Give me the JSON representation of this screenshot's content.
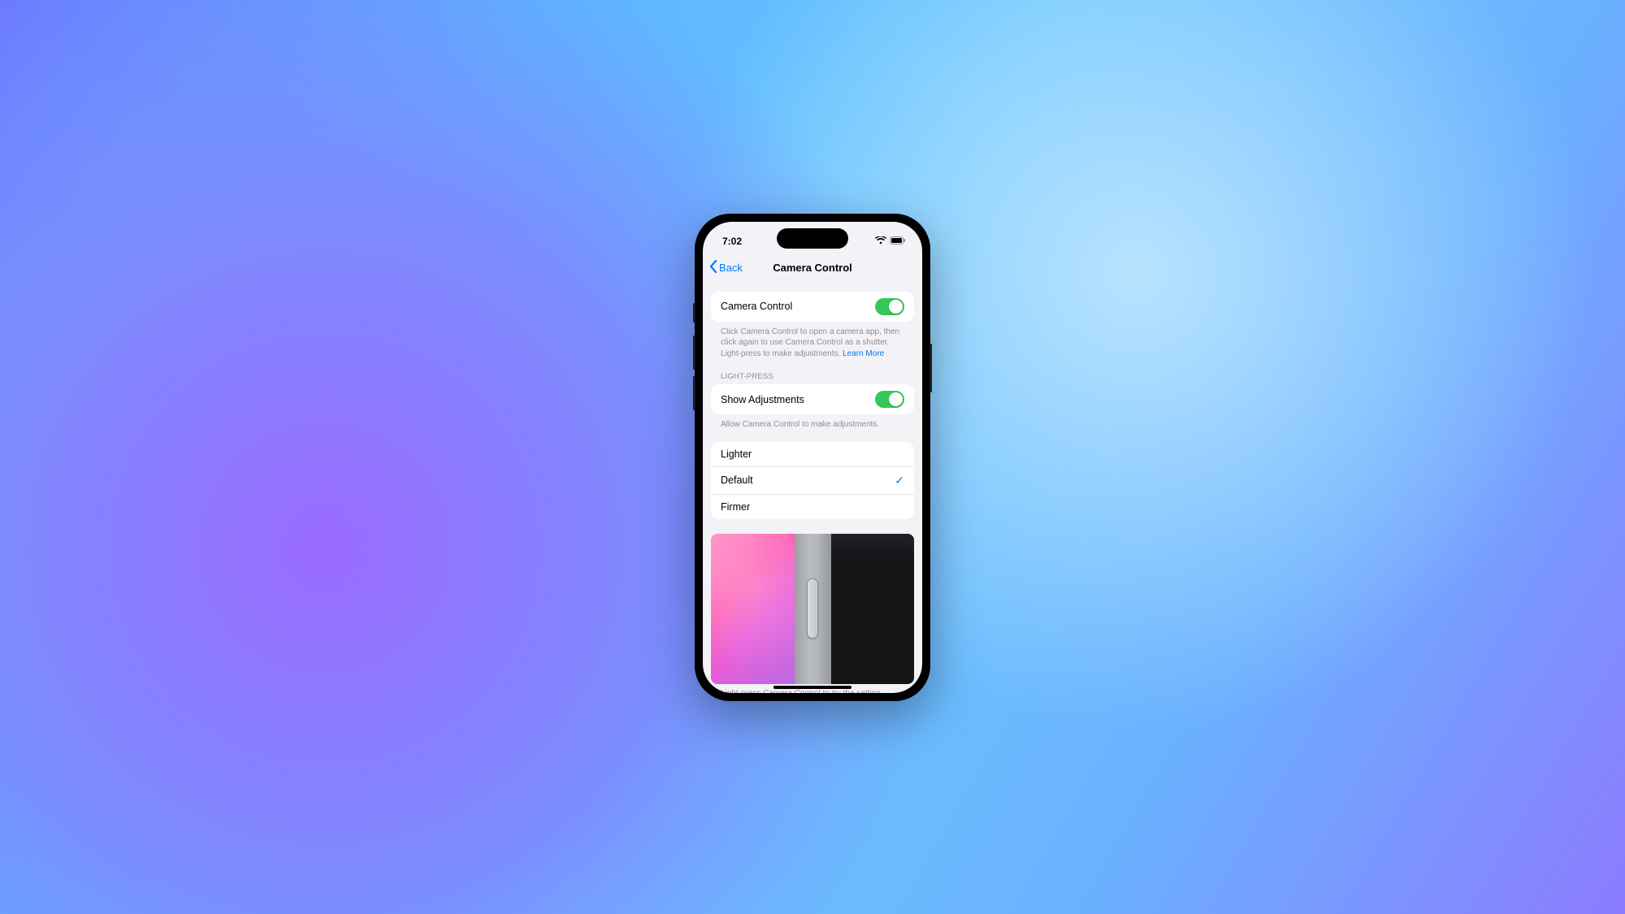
{
  "status": {
    "time": "7:02"
  },
  "nav": {
    "back": "Back",
    "title": "Camera Control"
  },
  "main_toggle": {
    "label": "Camera Control",
    "on": true,
    "footer": "Click Camera Control to open a camera app, then click again to use Camera Control as a shutter. Light-press to make adjustments. ",
    "learn_more": "Learn More"
  },
  "light_press": {
    "header": "LIGHT-PRESS",
    "toggle_label": "Show Adjustments",
    "toggle_on": true,
    "footer": "Allow Camera Control to make adjustments."
  },
  "sensitivity": {
    "options": [
      {
        "label": "Lighter",
        "selected": false
      },
      {
        "label": "Default",
        "selected": true
      },
      {
        "label": "Firmer",
        "selected": false
      }
    ]
  },
  "preview_footer": "Light-press Camera Control to try the setting.",
  "colors": {
    "accent": "#007aff",
    "toggle_on": "#34c759"
  }
}
